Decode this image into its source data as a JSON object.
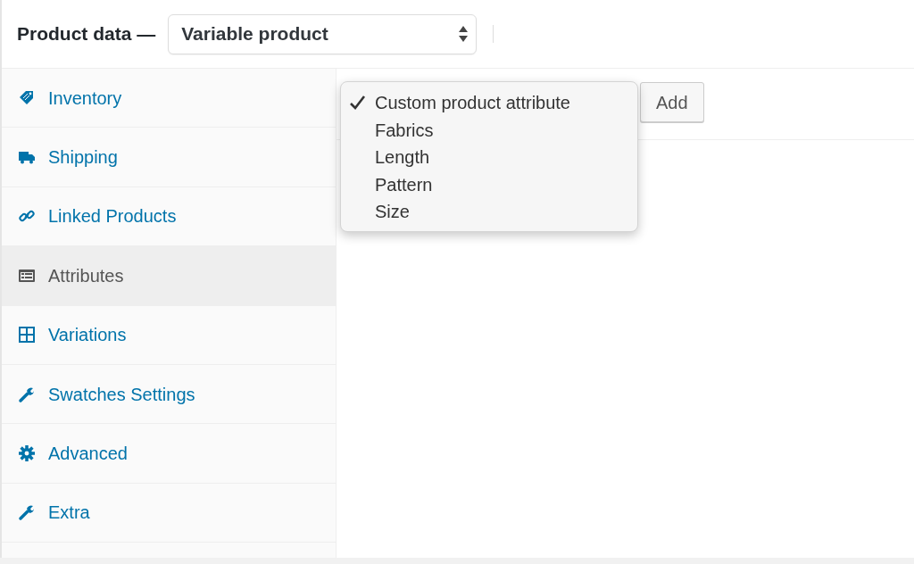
{
  "header": {
    "title": "Product data —",
    "product_type": "Variable product"
  },
  "tabs": [
    {
      "label": "Inventory",
      "selected": false
    },
    {
      "label": "Shipping",
      "selected": false
    },
    {
      "label": "Linked Products",
      "selected": false
    },
    {
      "label": "Attributes",
      "selected": true
    },
    {
      "label": "Variations",
      "selected": false
    },
    {
      "label": "Swatches Settings",
      "selected": false
    },
    {
      "label": "Advanced",
      "selected": false
    },
    {
      "label": "Extra",
      "selected": false
    }
  ],
  "attribute_dropdown": {
    "options": [
      {
        "label": "Custom product attribute",
        "selected": true
      },
      {
        "label": "Fabrics",
        "selected": false
      },
      {
        "label": "Length",
        "selected": false
      },
      {
        "label": "Pattern",
        "selected": false
      },
      {
        "label": "Size",
        "selected": false
      }
    ]
  },
  "add_button": "Add"
}
